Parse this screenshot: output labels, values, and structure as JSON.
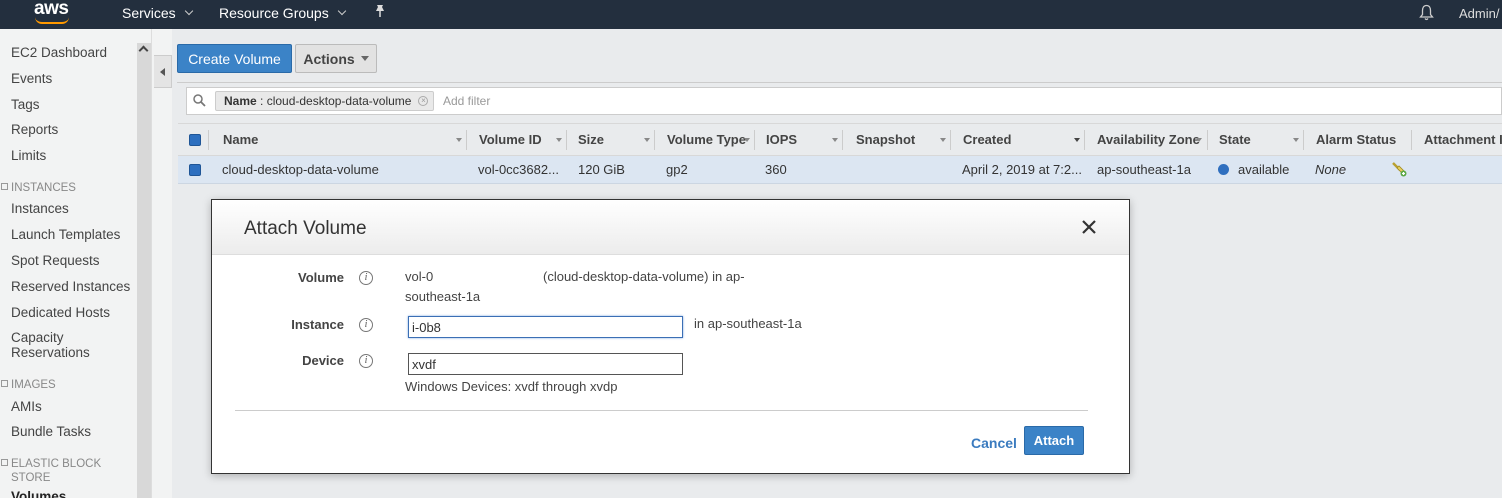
{
  "topnav": {
    "logo": "aws",
    "services_label": "Services",
    "resource_groups_label": "Resource Groups",
    "user_label": "Admin/"
  },
  "sidebar": {
    "items_top": [
      "EC2 Dashboard",
      "Events",
      "Tags",
      "Reports",
      "Limits"
    ],
    "section_instances": "INSTANCES",
    "instances_items": [
      "Instances",
      "Launch Templates",
      "Spot Requests",
      "Reserved Instances",
      "Dedicated Hosts",
      "Capacity Reservations"
    ],
    "section_images": "IMAGES",
    "images_items": [
      "AMIs",
      "Bundle Tasks"
    ],
    "section_ebs": "ELASTIC BLOCK STORE",
    "ebs_items": [
      "Volumes"
    ]
  },
  "toolbar": {
    "create_volume_label": "Create Volume",
    "actions_label": "Actions"
  },
  "filter": {
    "chip_key": "Name",
    "chip_value": "cloud-desktop-data-volume",
    "add_filter_placeholder": "Add filter"
  },
  "table": {
    "columns": [
      "Name",
      "Volume ID",
      "Size",
      "Volume Type",
      "IOPS",
      "Snapshot",
      "Created",
      "Availability Zone",
      "State",
      "Alarm Status",
      "Attachment In"
    ],
    "row": {
      "name": "cloud-desktop-data-volume",
      "volume_id": "vol-0cc3682...",
      "size": "120 GiB",
      "volume_type": "gp2",
      "iops": "360",
      "snapshot": "",
      "created": "April 2, 2019 at 7:2...",
      "availability_zone": "ap-southeast-1a",
      "state": "available",
      "alarm_status": "None",
      "attachment": ""
    }
  },
  "modal": {
    "title": "Attach Volume",
    "volume_label": "Volume",
    "volume_id": "vol-0",
    "volume_desc": "(cloud-desktop-data-volume) in ap-",
    "volume_desc_2": "southeast-1a",
    "instance_label": "Instance",
    "instance_value": "i-0b8",
    "instance_suffix": "in ap-southeast-1a",
    "device_label": "Device",
    "device_value": "xvdf",
    "device_hint": "Windows Devices: xvdf through xvdp",
    "cancel_label": "Cancel",
    "attach_label": "Attach"
  },
  "colors": {
    "nav_bg": "#232f3e",
    "primary": "#3b83c7",
    "selected_row": "#dce6f2",
    "state_available": "#2f6fbf"
  }
}
